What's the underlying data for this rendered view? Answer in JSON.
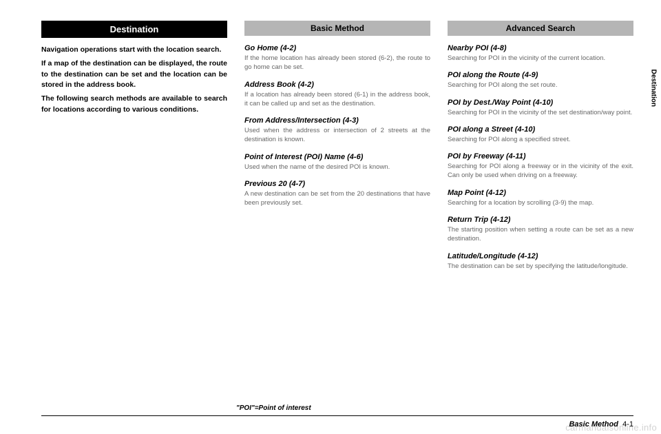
{
  "col1": {
    "header": "Destination",
    "p1": "Navigation operations start with the location search.",
    "p2": "If a map of the destination can be displayed, the route to the destination can be set and the location can be stored in the address book.",
    "p3": "The following search methods are available to search for locations according to various conditions."
  },
  "col2": {
    "header": "Basic Method",
    "items": [
      {
        "title": "Go Home (4-2)",
        "desc": "If the home location has already been stored (6-2), the route to go home can be set."
      },
      {
        "title": "Address Book (4-2)",
        "desc": "If a location has already been stored (6-1) in the address book, it can be called up and set as the destination."
      },
      {
        "title": "From Address/Intersection (4-3)",
        "desc": "Used when the address or intersection of 2 streets at the destination is known."
      },
      {
        "title": "Point of Interest (POI) Name (4-6)",
        "desc": "Used when the name of the desired POI is known."
      },
      {
        "title": "Previous 20 (4-7)",
        "desc": "A new destination can be set from the 20 destinations that have been previously set."
      }
    ]
  },
  "col3": {
    "header": "Advanced Search",
    "items": [
      {
        "title": "Nearby POI (4-8)",
        "desc": "Searching for POI in the vicinity of the current location."
      },
      {
        "title": "POI along the Route (4-9)",
        "desc": "Searching for POI along the set route."
      },
      {
        "title": "POI by Dest./Way Point (4-10)",
        "desc": "Searching for POI in the vicinity of the set destination/way point."
      },
      {
        "title": "POI along a Street (4-10)",
        "desc": "Searching for POI along a specified street."
      },
      {
        "title": "POI by Freeway (4-11)",
        "desc": "Searching for POI along a freeway or in the vicinity of the exit.\nCan only be used when driving on a freeway."
      },
      {
        "title": "Map Point (4-12)",
        "desc": "Searching for a location by scrolling (3-9) the map."
      },
      {
        "title": "Return Trip (4-12)",
        "desc": "The starting position when setting a route can be set as a new destination."
      },
      {
        "title": "Latitude/Longitude (4-12)",
        "desc": "The destination can be set by specifying the latitude/longitude."
      }
    ]
  },
  "poi_note": "\"POI\"=Point of interest",
  "side_tab": "Destination",
  "footer": {
    "name": "Basic Method",
    "page": "4-1"
  },
  "watermark": "carmanualsonline.info"
}
